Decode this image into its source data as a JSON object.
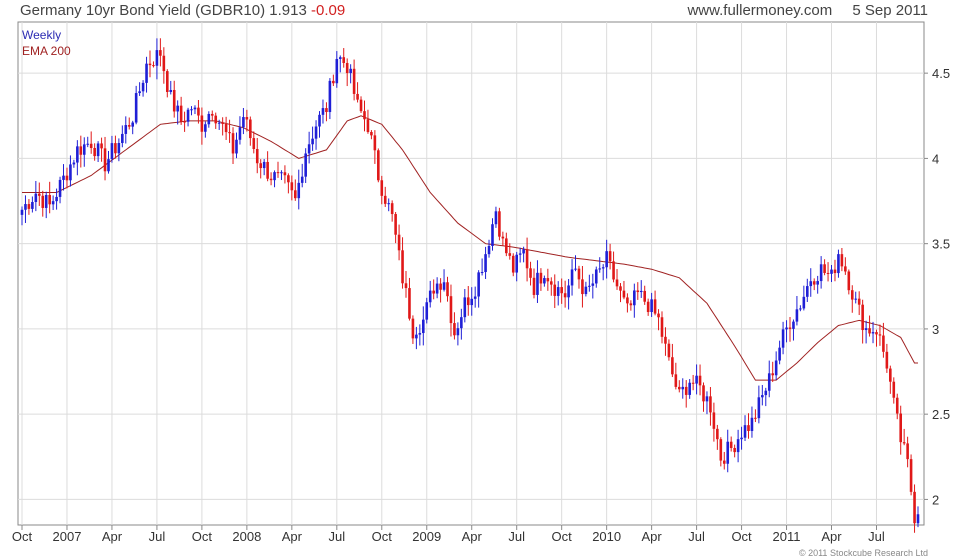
{
  "header": {
    "title": "Germany 10yr Bond Yield (GDBR10) 1.913",
    "change": "-0.09",
    "source": "www.fullermoney.com",
    "date": "5 Sep 2011"
  },
  "footer": {
    "copyright": "© 2011 Stockcube Research Ltd"
  },
  "chart_data": {
    "type": "candlestick",
    "y_axis_position": "right",
    "ylim": [
      1.85,
      4.8
    ],
    "yticks": [
      2,
      2.5,
      3,
      3.5,
      4,
      4.5
    ],
    "ytick_labels": [
      "2",
      "2.5",
      "3",
      "3.5",
      "4",
      "4.5"
    ],
    "xlim": [
      0,
      259
    ],
    "xticks": [
      {
        "week": 0,
        "label": "Oct"
      },
      {
        "week": 13,
        "label": "2007"
      },
      {
        "week": 26,
        "label": "Apr"
      },
      {
        "week": 39,
        "label": "Jul"
      },
      {
        "week": 52,
        "label": "Oct"
      },
      {
        "week": 65,
        "label": "2008"
      },
      {
        "week": 78,
        "label": "Apr"
      },
      {
        "week": 91,
        "label": "Jul"
      },
      {
        "week": 104,
        "label": "Oct"
      },
      {
        "week": 117,
        "label": "2009"
      },
      {
        "week": 130,
        "label": "Apr"
      },
      {
        "week": 143,
        "label": "Jul"
      },
      {
        "week": 156,
        "label": "Oct"
      },
      {
        "week": 169,
        "label": "2010"
      },
      {
        "week": 182,
        "label": "Apr"
      },
      {
        "week": 195,
        "label": "Jul"
      },
      {
        "week": 208,
        "label": "Oct"
      },
      {
        "week": 221,
        "label": "2011"
      },
      {
        "week": 234,
        "label": "Apr"
      },
      {
        "week": 247,
        "label": "Jul"
      }
    ],
    "grid": true,
    "legend": [
      {
        "name": "Weekly",
        "color": "#2b2bb3"
      },
      {
        "name": "EMA 200",
        "color": "#a02222"
      }
    ],
    "legend_position": "top-left",
    "colors": {
      "up": "#1f1fd6",
      "down": "#e01818",
      "ema": "#a02222"
    },
    "weekly_close_anchors": [
      [
        0,
        3.7
      ],
      [
        4,
        3.8
      ],
      [
        8,
        3.72
      ],
      [
        12,
        3.88
      ],
      [
        16,
        4.05
      ],
      [
        20,
        4.1
      ],
      [
        24,
        3.97
      ],
      [
        28,
        4.1
      ],
      [
        32,
        4.25
      ],
      [
        36,
        4.55
      ],
      [
        40,
        4.62
      ],
      [
        43,
        4.35
      ],
      [
        46,
        4.22
      ],
      [
        49,
        4.3
      ],
      [
        52,
        4.2
      ],
      [
        55,
        4.3
      ],
      [
        58,
        4.18
      ],
      [
        61,
        4.05
      ],
      [
        64,
        4.25
      ],
      [
        68,
        4.0
      ],
      [
        72,
        3.9
      ],
      [
        76,
        3.85
      ],
      [
        79,
        3.75
      ],
      [
        82,
        4.05
      ],
      [
        85,
        4.2
      ],
      [
        88,
        4.3
      ],
      [
        91,
        4.6
      ],
      [
        94,
        4.55
      ],
      [
        97,
        4.3
      ],
      [
        100,
        4.2
      ],
      [
        103,
        3.9
      ],
      [
        107,
        3.65
      ],
      [
        110,
        3.3
      ],
      [
        113,
        3.0
      ],
      [
        116,
        3.05
      ],
      [
        119,
        3.25
      ],
      [
        122,
        3.3
      ],
      [
        125,
        2.98
      ],
      [
        128,
        3.15
      ],
      [
        131,
        3.25
      ],
      [
        134,
        3.45
      ],
      [
        137,
        3.7
      ],
      [
        139,
        3.5
      ],
      [
        142,
        3.35
      ],
      [
        145,
        3.45
      ],
      [
        148,
        3.25
      ],
      [
        151,
        3.35
      ],
      [
        154,
        3.25
      ],
      [
        157,
        3.2
      ],
      [
        160,
        3.35
      ],
      [
        163,
        3.2
      ],
      [
        166,
        3.3
      ],
      [
        169,
        3.4
      ],
      [
        172,
        3.25
      ],
      [
        175,
        3.1
      ],
      [
        178,
        3.2
      ],
      [
        181,
        3.15
      ],
      [
        184,
        3.05
      ],
      [
        187,
        2.8
      ],
      [
        190,
        2.6
      ],
      [
        193,
        2.7
      ],
      [
        196,
        2.65
      ],
      [
        199,
        2.55
      ],
      [
        202,
        2.25
      ],
      [
        205,
        2.3
      ],
      [
        208,
        2.4
      ],
      [
        211,
        2.45
      ],
      [
        213,
        2.55
      ],
      [
        216,
        2.7
      ],
      [
        219,
        2.9
      ],
      [
        222,
        3.05
      ],
      [
        225,
        3.15
      ],
      [
        228,
        3.3
      ],
      [
        231,
        3.35
      ],
      [
        234,
        3.3
      ],
      [
        236,
        3.45
      ],
      [
        238,
        3.35
      ],
      [
        241,
        3.15
      ],
      [
        244,
        3.0
      ],
      [
        247,
        3.0
      ],
      [
        250,
        2.8
      ],
      [
        252,
        2.55
      ],
      [
        254,
        2.35
      ],
      [
        256,
        2.2
      ],
      [
        258,
        1.91
      ]
    ],
    "ema200_anchors": [
      [
        0,
        3.8
      ],
      [
        10,
        3.8
      ],
      [
        20,
        3.9
      ],
      [
        30,
        4.05
      ],
      [
        40,
        4.2
      ],
      [
        48,
        4.22
      ],
      [
        56,
        4.22
      ],
      [
        64,
        4.18
      ],
      [
        72,
        4.1
      ],
      [
        80,
        4.0
      ],
      [
        88,
        4.05
      ],
      [
        94,
        4.22
      ],
      [
        98,
        4.25
      ],
      [
        104,
        4.2
      ],
      [
        110,
        4.05
      ],
      [
        118,
        3.8
      ],
      [
        126,
        3.62
      ],
      [
        134,
        3.5
      ],
      [
        142,
        3.48
      ],
      [
        150,
        3.45
      ],
      [
        158,
        3.42
      ],
      [
        166,
        3.4
      ],
      [
        174,
        3.38
      ],
      [
        182,
        3.35
      ],
      [
        190,
        3.3
      ],
      [
        198,
        3.15
      ],
      [
        206,
        2.9
      ],
      [
        212,
        2.7
      ],
      [
        218,
        2.7
      ],
      [
        224,
        2.8
      ],
      [
        230,
        2.92
      ],
      [
        236,
        3.02
      ],
      [
        242,
        3.05
      ],
      [
        248,
        3.02
      ],
      [
        254,
        2.95
      ],
      [
        258,
        2.8
      ]
    ],
    "latest_close": 1.913,
    "latest_change": -0.09
  }
}
